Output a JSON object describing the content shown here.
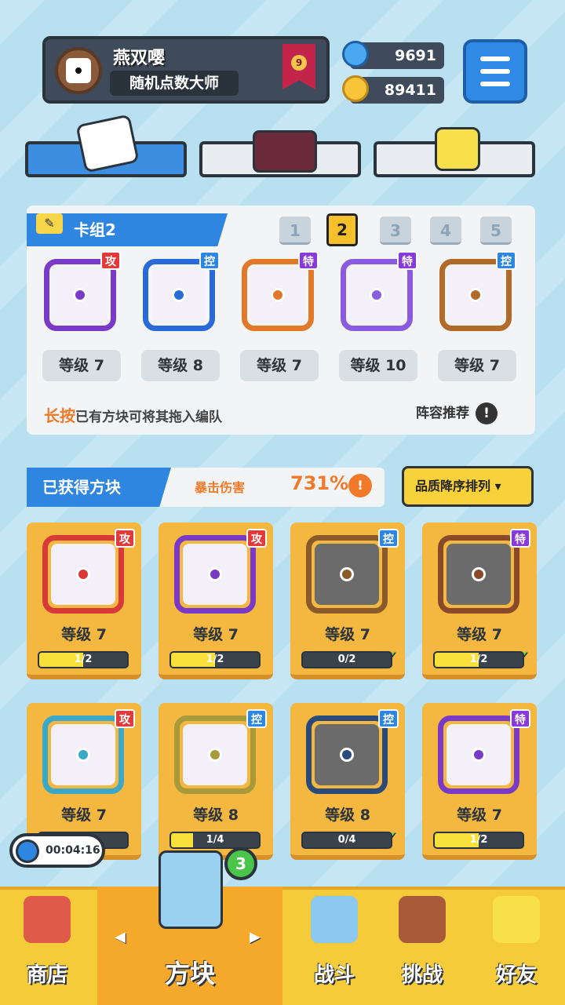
{
  "player": {
    "name": "燕双嘤",
    "title": "随机点数大师",
    "rank": "9"
  },
  "currency": {
    "gems": "9691",
    "gold": "89411"
  },
  "deck": {
    "title": "卡组2",
    "tabs": [
      "1",
      "2",
      "3",
      "4",
      "5"
    ],
    "active_tab": "2",
    "cards": [
      {
        "tag": "攻",
        "level": "等级 7",
        "color": "#7a3ac8",
        "tagcolor": "#e03a3a"
      },
      {
        "tag": "控",
        "level": "等级 8",
        "color": "#2a6ad8",
        "tagcolor": "#2f86e0"
      },
      {
        "tag": "特",
        "level": "等级 7",
        "color": "#e07a2a",
        "tagcolor": "#8a3ad8"
      },
      {
        "tag": "特",
        "level": "等级 10",
        "color": "#8a5ae0",
        "tagcolor": "#8a3ad8"
      },
      {
        "tag": "控",
        "level": "等级 7",
        "color": "#b06a2a",
        "tagcolor": "#2f86e0"
      }
    ],
    "hint_highlight": "长按",
    "hint_text": "已有方块可将其拖入编队",
    "recommend": "阵容推荐"
  },
  "owned": {
    "title": "已获得方块",
    "crit_label": "暴击伤害",
    "crit_value": "731%",
    "sort": "品质降序排列 ▾",
    "cards": [
      {
        "tag": "攻",
        "tagcolor": "#e03a3a",
        "color": "#d83a3a",
        "level": "等级 7",
        "progress": "1/2",
        "frac": 0.5,
        "dim": false
      },
      {
        "tag": "攻",
        "tagcolor": "#e03a3a",
        "color": "#7a3ac8",
        "level": "等级 7",
        "progress": "1/2",
        "frac": 0.5,
        "dim": false
      },
      {
        "tag": "控",
        "tagcolor": "#2f86e0",
        "color": "#8a5a2a",
        "level": "等级 7",
        "progress": "0/2",
        "frac": 0,
        "dim": true
      },
      {
        "tag": "特",
        "tagcolor": "#8a3ad8",
        "color": "#8a4a2a",
        "level": "等级 7",
        "progress": "1/2",
        "frac": 0.5,
        "dim": true
      },
      {
        "tag": "攻",
        "tagcolor": "#e03a3a",
        "color": "#3aa8c8",
        "level": "等级 7",
        "progress": "",
        "frac": 0.4,
        "dim": false
      },
      {
        "tag": "控",
        "tagcolor": "#2f86e0",
        "color": "#a89a3a",
        "level": "等级 8",
        "progress": "1/4",
        "frac": 0.25,
        "dim": false
      },
      {
        "tag": "控",
        "tagcolor": "#2f86e0",
        "color": "#2a4a7a",
        "level": "等级 8",
        "progress": "0/4",
        "frac": 0,
        "dim": true
      },
      {
        "tag": "特",
        "tagcolor": "#8a3ad8",
        "color": "#7a3ac8",
        "level": "等级 7",
        "progress": "1/2",
        "frac": 0.5,
        "dim": false
      }
    ]
  },
  "timer": "00:04:16",
  "nav": {
    "shop": "商店",
    "blocks": "方块",
    "battle": "战斗",
    "challenge": "挑战",
    "friends": "好友",
    "badge": "3"
  }
}
